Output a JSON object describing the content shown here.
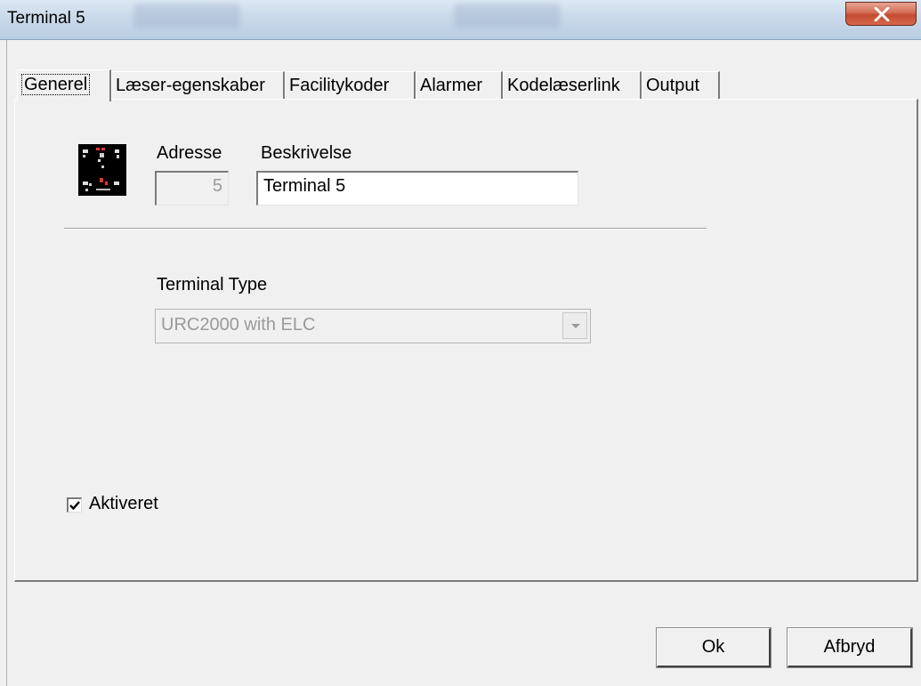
{
  "window": {
    "title": "Terminal 5",
    "close_symbol": "X"
  },
  "tabs": [
    {
      "label": "Generel",
      "active": true
    },
    {
      "label": "Læser-egenskaber",
      "active": false
    },
    {
      "label": "Facilitykoder",
      "active": false
    },
    {
      "label": "Alarmer",
      "active": false
    },
    {
      "label": "Kodelæserlink",
      "active": false
    },
    {
      "label": "Output",
      "active": false
    }
  ],
  "general": {
    "icon": "terminal-device-icon",
    "address_label": "Adresse",
    "address_value": "5",
    "description_label": "Beskrivelse",
    "description_value": "Terminal 5",
    "terminal_type_label": "Terminal Type",
    "terminal_type_value": "URC2000 with ELC",
    "activated_label": "Aktiveret",
    "activated_checked": true
  },
  "buttons": {
    "ok_label": "Ok",
    "cancel_label": "Afbryd"
  },
  "colors": {
    "dialog_bg": "#f0f0f0",
    "close_button": "#c9502f",
    "disabled_text": "#9a9a9a"
  }
}
